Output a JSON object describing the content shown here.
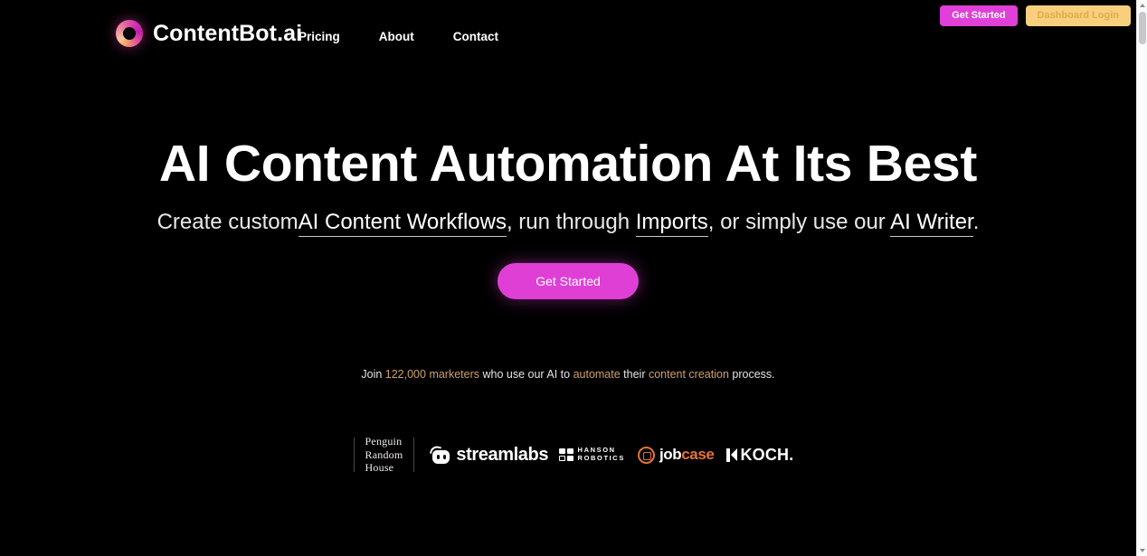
{
  "header": {
    "brand": {
      "logo_icon": "contentbot-ring-logo",
      "name": "ContentBot.ai"
    },
    "nav": [
      {
        "label": "Pricing"
      },
      {
        "label": "About"
      },
      {
        "label": "Contact"
      }
    ],
    "actions": {
      "get_started_label": "Get Started",
      "dashboard_login_label": "Dashboard Login",
      "get_started_color": "#e040d8",
      "dashboard_login_color": "#f8cf7c"
    }
  },
  "hero": {
    "title": "AI Content Automation At Its Best",
    "subtitle": {
      "part1": "Create custom",
      "link1": "AI Content Workflows",
      "part2": ", run through ",
      "link2": "Imports",
      "part3": ", or simply use our ",
      "link3": "AI Writer",
      "part4": "."
    },
    "cta_label": "Get Started",
    "cta_color": "#e03fd6"
  },
  "social_proof": {
    "prefix": "Join ",
    "count": "122,000 marketers",
    "middle": " who use our AI to ",
    "highlight2": "automate",
    "middle2": " their ",
    "highlight3": "content creation",
    "suffix": " process.",
    "highlight_color": "#cfa06a"
  },
  "logos": {
    "penguin": {
      "line1": "Penguin",
      "line2": "Random",
      "line3": "House"
    },
    "streamlabs": {
      "name": "streamlabs",
      "icon": "streamlabs-mask-icon"
    },
    "hanson": {
      "line1": "HANSON",
      "line2": "ROBOTICS",
      "icon": "hanson-grid-icon"
    },
    "jobcase": {
      "part1": "job",
      "part2": "case",
      "icon": "jobcase-at-icon"
    },
    "koch": {
      "name": "KOCH.",
      "icon": "koch-arrow-icon"
    }
  },
  "scrollbar": {
    "up_icon": "scroll-up-arrow-icon",
    "down_icon": "scroll-down-arrow-icon"
  }
}
